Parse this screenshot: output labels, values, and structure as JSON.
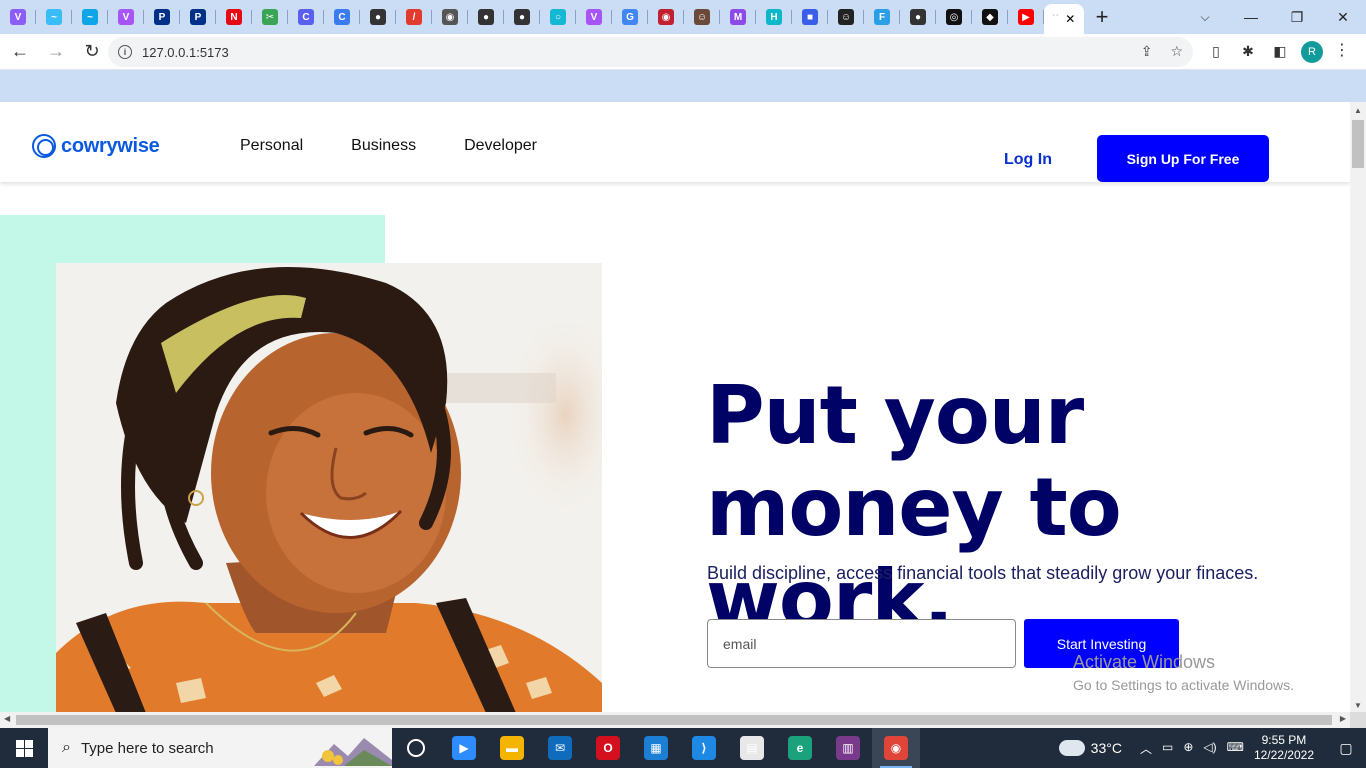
{
  "browser": {
    "tabs": [
      {
        "icon": "vite-icon",
        "glyph": "V",
        "color": "#8b5cf6"
      },
      {
        "icon": "tailwind-icon",
        "glyph": "~",
        "color": "#38bdf8"
      },
      {
        "icon": "tailwind-icon",
        "glyph": "~",
        "color": "#0ea5e9"
      },
      {
        "icon": "vite-icon",
        "glyph": "V",
        "color": "#a855f7"
      },
      {
        "icon": "paypal-icon",
        "glyph": "P",
        "color": "#003087"
      },
      {
        "icon": "paypal-icon",
        "glyph": "P",
        "color": "#003087"
      },
      {
        "icon": "netflix-icon",
        "glyph": "N",
        "color": "#e50914"
      },
      {
        "icon": "scissors-icon",
        "glyph": "✂",
        "color": "#3aa655"
      },
      {
        "icon": "canva-icon",
        "glyph": "C",
        "color": "#5b5ff0"
      },
      {
        "icon": "canva-icon",
        "glyph": "C",
        "color": "#3a7cf0"
      },
      {
        "icon": "globe-icon",
        "glyph": "●",
        "color": "#333333"
      },
      {
        "icon": "pen-icon",
        "glyph": "/",
        "color": "#e23b2e"
      },
      {
        "icon": "chrome-icon",
        "glyph": "◉",
        "color": "#555555"
      },
      {
        "icon": "globe-icon",
        "glyph": "●",
        "color": "#333333"
      },
      {
        "icon": "globe-icon",
        "glyph": "●",
        "color": "#333333"
      },
      {
        "icon": "circle-icon",
        "glyph": "○",
        "color": "#14b8d4"
      },
      {
        "icon": "vite-icon",
        "glyph": "V",
        "color": "#a855f7"
      },
      {
        "icon": "google-icon",
        "glyph": "G",
        "color": "#4285f4"
      },
      {
        "icon": "record-icon",
        "glyph": "◉",
        "color": "#c02030"
      },
      {
        "icon": "avatar-icon",
        "glyph": "☺",
        "color": "#6b4a3a"
      },
      {
        "icon": "mastodon-icon",
        "glyph": "M",
        "color": "#8c4ae8"
      },
      {
        "icon": "hashnode-icon",
        "glyph": "H",
        "color": "#0bb7c9"
      },
      {
        "icon": "square-icon",
        "glyph": "■",
        "color": "#3b5ee8"
      },
      {
        "icon": "avatar-icon",
        "glyph": "☺",
        "color": "#222222"
      },
      {
        "icon": "flutter-icon",
        "glyph": "F",
        "color": "#2a9fe8"
      },
      {
        "icon": "globe-icon",
        "glyph": "●",
        "color": "#333333"
      },
      {
        "icon": "github-icon",
        "glyph": "◎",
        "color": "#111111"
      },
      {
        "icon": "codepen-icon",
        "glyph": "◆",
        "color": "#111111"
      },
      {
        "icon": "youtube-icon",
        "glyph": "▶",
        "color": "#ff0000"
      }
    ],
    "url": "127.0.0.1:5173",
    "profile_initial": "R"
  },
  "site": {
    "logo_text": "cowrywise",
    "nav": [
      "Personal",
      "Business",
      "Developer"
    ],
    "login_label": "Log In",
    "signup_label": "Sign Up For Free",
    "headline_line1": "Put your",
    "headline_line2": "money to work.",
    "subline": "Build discipline, access financial tools that steadily grow your finaces.",
    "email_placeholder": "email",
    "start_label": "Start Investing",
    "colors": {
      "brand": "#0000ff",
      "headline": "#000266",
      "mint": "#c3f7e8"
    }
  },
  "watermark": {
    "line1": "Activate Windows",
    "line2": "Go to Settings to activate Windows."
  },
  "taskbar": {
    "search_placeholder": "Type here to search",
    "apps": [
      {
        "name": "task-view-icon",
        "glyph": "○",
        "color": "transparent"
      },
      {
        "name": "zoom-icon",
        "glyph": "▶",
        "color": "#2d8cff"
      },
      {
        "name": "file-explorer-icon",
        "glyph": "▬",
        "color": "#f4b400"
      },
      {
        "name": "mail-icon",
        "glyph": "✉",
        "color": "#0f6cbd"
      },
      {
        "name": "opera-icon",
        "glyph": "O",
        "color": "#d4101e"
      },
      {
        "name": "store-icon",
        "glyph": "▦",
        "color": "#1b7fd6"
      },
      {
        "name": "vscode-icon",
        "glyph": "⟩",
        "color": "#1e88e5"
      },
      {
        "name": "notepad-icon",
        "glyph": "▤",
        "color": "#e8e8e8"
      },
      {
        "name": "edge-icon",
        "glyph": "e",
        "color": "#1ba27c"
      },
      {
        "name": "winrar-icon",
        "glyph": "▥",
        "color": "#7a3a8c"
      },
      {
        "name": "chrome-icon",
        "glyph": "◉",
        "color": "#e0453a"
      }
    ],
    "weather": "33°C",
    "time": "9:55 PM",
    "date": "12/22/2022"
  }
}
